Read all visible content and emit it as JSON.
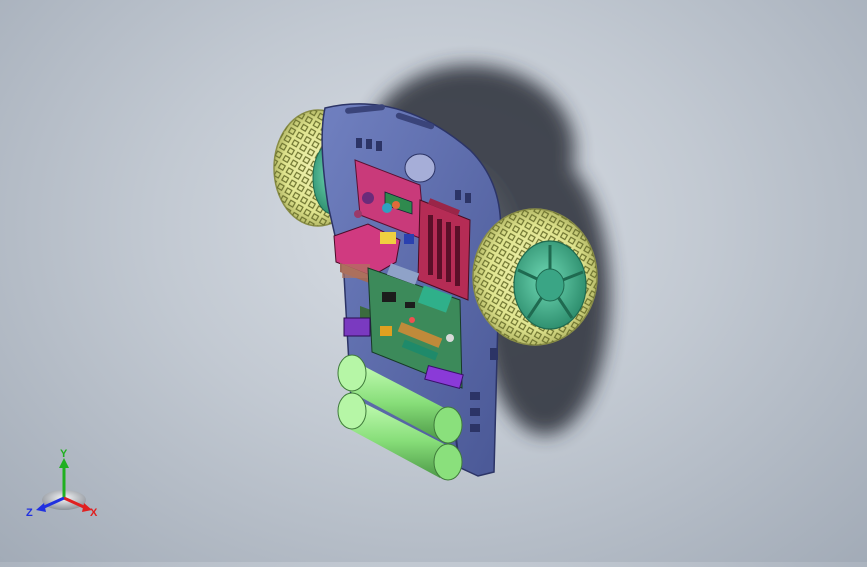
{
  "viewport": {
    "background_top": "#d8dde4",
    "background_bottom": "#a2abb7",
    "model": {
      "chassis_color": "#5a6aa8",
      "tire_color": "#e4e89a",
      "rim_color": "#45b995",
      "battery_color": "#9ef08e",
      "board_color": "#3c8a5a",
      "driver_board_color": "#d0397a",
      "breadboard_color": "#b8305a",
      "icons": [
        "robot-car-model-icon",
        "wheel-icon",
        "battery-icon",
        "circuit-board-icon"
      ]
    }
  },
  "triad": {
    "y_label": "Y",
    "x_label": "X",
    "z_label": "Z",
    "colors": {
      "x": "#e02020",
      "y": "#20b020",
      "z": "#2030e0"
    }
  }
}
